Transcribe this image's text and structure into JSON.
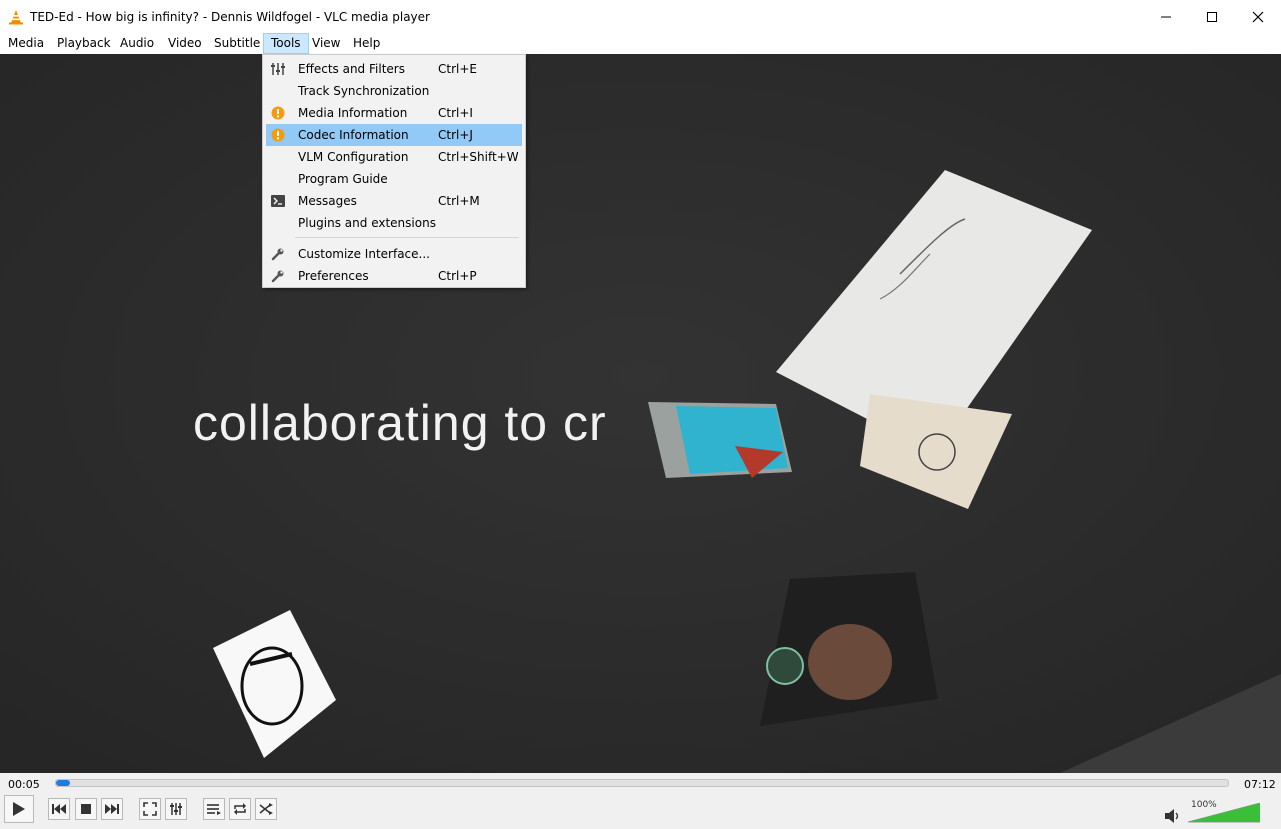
{
  "window": {
    "title": "TED-Ed - How big is infinity? - Dennis Wildfogel - VLC media player",
    "app_icon": "vlc-cone-icon",
    "controls": [
      "minimize-icon",
      "maximize-icon",
      "close-icon"
    ]
  },
  "menubar": {
    "items": [
      {
        "label": "Media"
      },
      {
        "label": "Playback"
      },
      {
        "label": "Audio"
      },
      {
        "label": "Video"
      },
      {
        "label": "Subtitle"
      },
      {
        "label": "Tools",
        "active": true
      },
      {
        "label": "View"
      },
      {
        "label": "Help"
      }
    ]
  },
  "tools_menu": {
    "items": [
      {
        "label": "Effects and Filters",
        "shortcut": "Ctrl+E",
        "icon": "equalizer-icon"
      },
      {
        "label": "Track Synchronization",
        "shortcut": "",
        "icon": ""
      },
      {
        "label": "Media Information",
        "shortcut": "Ctrl+I",
        "icon": "info-icon"
      },
      {
        "label": "Codec Information",
        "shortcut": "Ctrl+J",
        "icon": "info-icon",
        "highlighted": true
      },
      {
        "label": "VLM Configuration",
        "shortcut": "Ctrl+Shift+W",
        "icon": ""
      },
      {
        "label": "Program Guide",
        "shortcut": "",
        "icon": ""
      },
      {
        "label": "Messages",
        "shortcut": "Ctrl+M",
        "icon": "terminal-icon"
      },
      {
        "label": "Plugins and extensions",
        "shortcut": "",
        "icon": ""
      },
      {
        "label": "Customize Interface...",
        "shortcut": "",
        "icon": "wrench-icon"
      },
      {
        "label": "Preferences",
        "shortcut": "Ctrl+P",
        "icon": "wrench-icon"
      }
    ],
    "highlight_color": "#91c9f7",
    "info_icon_color": "#f39c12"
  },
  "video": {
    "caption_text": "collaborating to cr",
    "background": "#2b2b2b"
  },
  "controls": {
    "elapsed": "00:05",
    "total": "07:12",
    "progress_fraction": 0.012,
    "volume_label": "100%",
    "volume_fraction": 1.0,
    "accent": "#1f7be0",
    "volume_color": "#3bbf3b",
    "buttons": [
      "play-icon",
      "previous-icon",
      "stop-icon",
      "next-icon",
      "fullscreen-icon",
      "extended-settings-icon",
      "playlist-icon",
      "loop-icon",
      "shuffle-icon"
    ]
  }
}
